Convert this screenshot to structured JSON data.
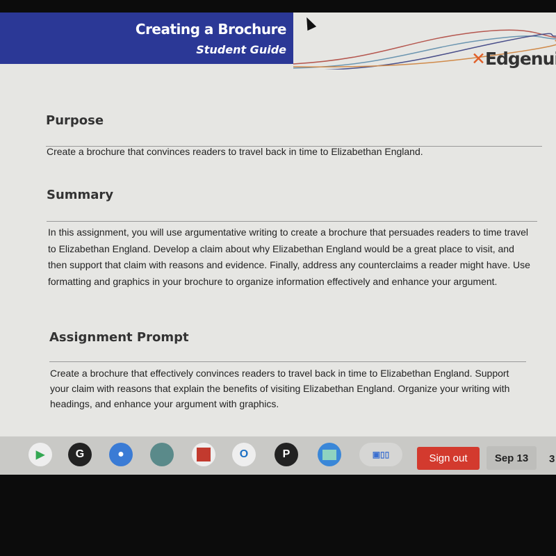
{
  "header": {
    "title": "Creating a Brochure",
    "subtitle": "Student Guide",
    "logo_text": "Edgenuit"
  },
  "sections": [
    {
      "heading": "Purpose",
      "body": "Create a brochure that convinces readers to travel back in time to Elizabethan England."
    },
    {
      "heading": "Summary",
      "body": "In this assignment, you will use argumentative writing to create a brochure that persuades readers to time travel to Elizabethan England. Develop a claim about why Elizabethan England would be a great place to visit, and then support that claim with reasons and evidence. Finally, address any counterclaims a reader might have. Use formatting and graphics in your brochure to organize information effectively and enhance your argument."
    },
    {
      "heading": "Assignment Prompt",
      "body": "Create a brochure that effectively convinces readers to travel back in time to Elizabethan England. Support your claim with reasons that explain the benefits of visiting Elizabethan England. Organize your writing with headings, and enhance your argument with graphics."
    }
  ],
  "taskbar": {
    "apps": [
      {
        "icon": "play-store-icon",
        "label": ""
      },
      {
        "icon": "g-app-icon",
        "label": "G"
      },
      {
        "icon": "camera-icon",
        "label": ""
      },
      {
        "icon": "earth-icon",
        "label": ""
      },
      {
        "icon": "red-app-icon",
        "label": ""
      },
      {
        "icon": "outlook-icon",
        "label": "O"
      },
      {
        "icon": "p-app-icon",
        "label": "P"
      },
      {
        "icon": "files-icon",
        "label": ""
      }
    ],
    "sign_out": "Sign out",
    "date": "Sep 13",
    "time": "3"
  },
  "colors": {
    "banner": "#2b3896",
    "sign_out": "#d33a2e",
    "logo_x": "#e0602a"
  }
}
